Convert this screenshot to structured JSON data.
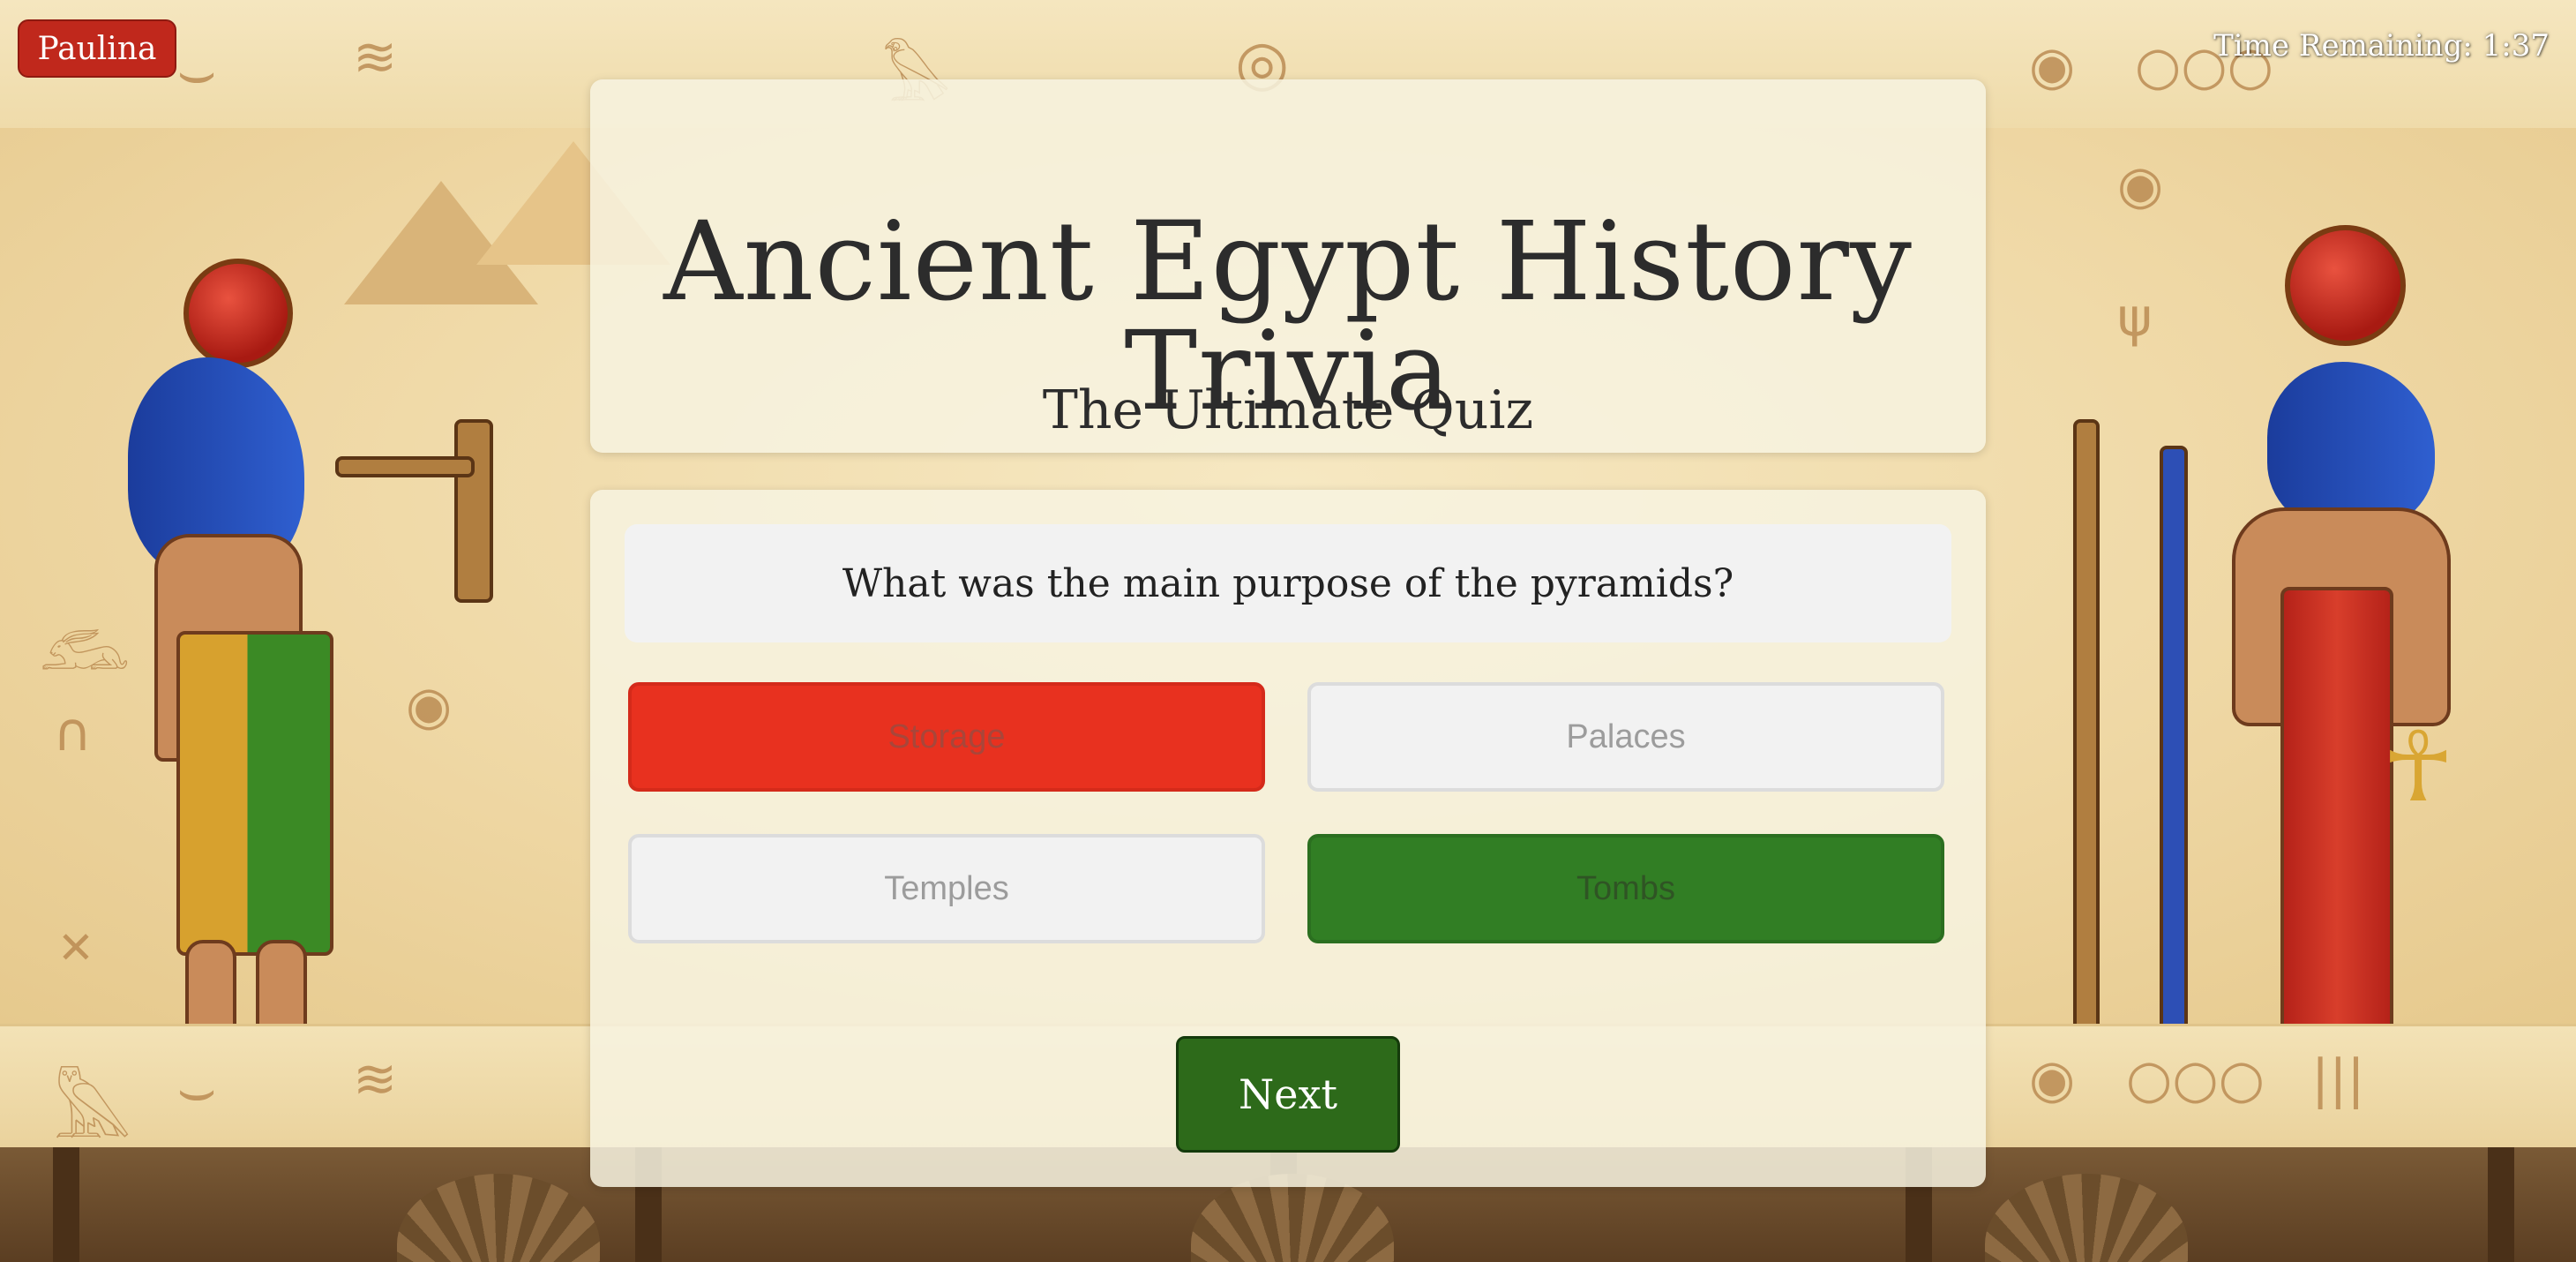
{
  "header": {
    "user_name": "Paulina",
    "time_remaining": "Time Remaining: 1:37"
  },
  "title_panel": {
    "title": "Ancient Egypt History Trivia",
    "subtitle": "The Ultimate Quiz"
  },
  "quiz": {
    "question": "What was the main purpose of the pyramids?",
    "answers": [
      {
        "label": "Storage",
        "state": "wrong"
      },
      {
        "label": "Palaces",
        "state": "neutral"
      },
      {
        "label": "Temples",
        "state": "neutral"
      },
      {
        "label": "Tombs",
        "state": "correct"
      }
    ],
    "next_label": "Next"
  },
  "colors": {
    "wrong": "#e8311f",
    "correct": "#317e24",
    "neutral": "#f2f2f2",
    "next_button": "#2d6a1a",
    "user_badge": "#c0281c"
  }
}
